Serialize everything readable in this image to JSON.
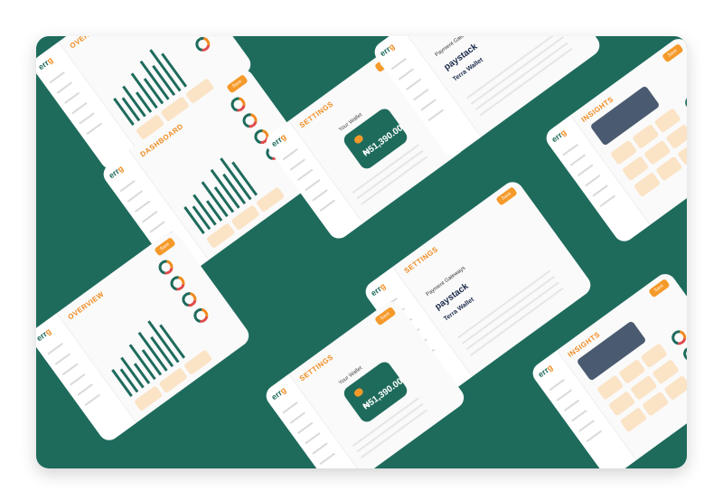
{
  "colors": {
    "frame": "#1e6b5c",
    "accent": "#f08a1e",
    "card": "#fafafa",
    "tile": "#fbe3c6",
    "dark": "#4a5a70"
  },
  "brand": {
    "logo_prefix": "err",
    "logo_suffix": "g"
  },
  "cards": [
    {
      "kind": "overview",
      "title": "OVERVIEW",
      "button": "Save"
    },
    {
      "kind": "dashboard",
      "title": "DASHBOARD",
      "button": "Save"
    },
    {
      "kind": "settings_wallet",
      "title": "SETTINGS",
      "wallet_label": "Your Wallet",
      "wallet_amount": "₦51,390.00",
      "button": "Save"
    },
    {
      "kind": "settings_payment",
      "title": "SETTINGS",
      "section": "Payment Gateways",
      "providers": [
        "paystack",
        "Terra Wallet"
      ],
      "button": "Save"
    },
    {
      "kind": "insights",
      "title": "INSIGHTS",
      "button": "Save"
    },
    {
      "kind": "overview",
      "title": "OVERVIEW",
      "button": "Save"
    },
    {
      "kind": "settings_payment",
      "title": "SETTINGS",
      "section": "Payment Gateways",
      "providers": [
        "paystack",
        "Terra Wallet"
      ],
      "button": "Save"
    },
    {
      "kind": "insights",
      "title": "INSIGHTS",
      "button": "Save"
    },
    {
      "kind": "settings_wallet",
      "title": "SETTINGS",
      "wallet_label": "Your Wallet",
      "wallet_amount": "₦51,390.00",
      "button": "Save"
    }
  ]
}
